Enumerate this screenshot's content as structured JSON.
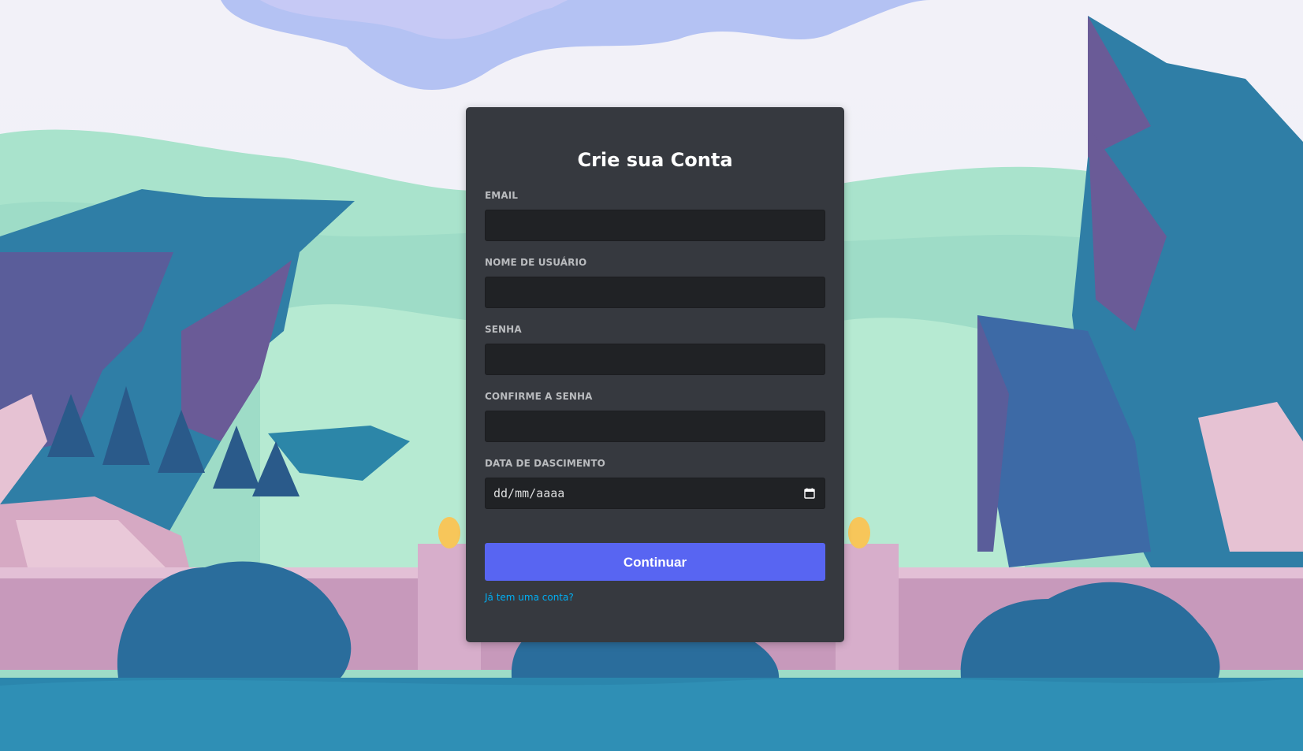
{
  "form": {
    "title": "Crie sua Conta",
    "fields": [
      {
        "label": "EMAIL",
        "value": ""
      },
      {
        "label": "NOME DE USUÁRIO",
        "value": ""
      },
      {
        "label": "SENHA",
        "value": ""
      },
      {
        "label": "CONFIRME A SENHA",
        "value": ""
      },
      {
        "label": "DATA DE DASCIMENTO",
        "value": "",
        "placeholder": "dd/mm/aaaa"
      }
    ],
    "submit_label": "Continuar",
    "login_link": "Já tem uma conta?"
  },
  "icons": {
    "calendar": "calendar-icon"
  },
  "colors": {
    "card_bg": "#36393f",
    "input_bg": "#202225",
    "button": "#5865f2",
    "link": "#00aff4",
    "label": "#b9bbbe"
  }
}
